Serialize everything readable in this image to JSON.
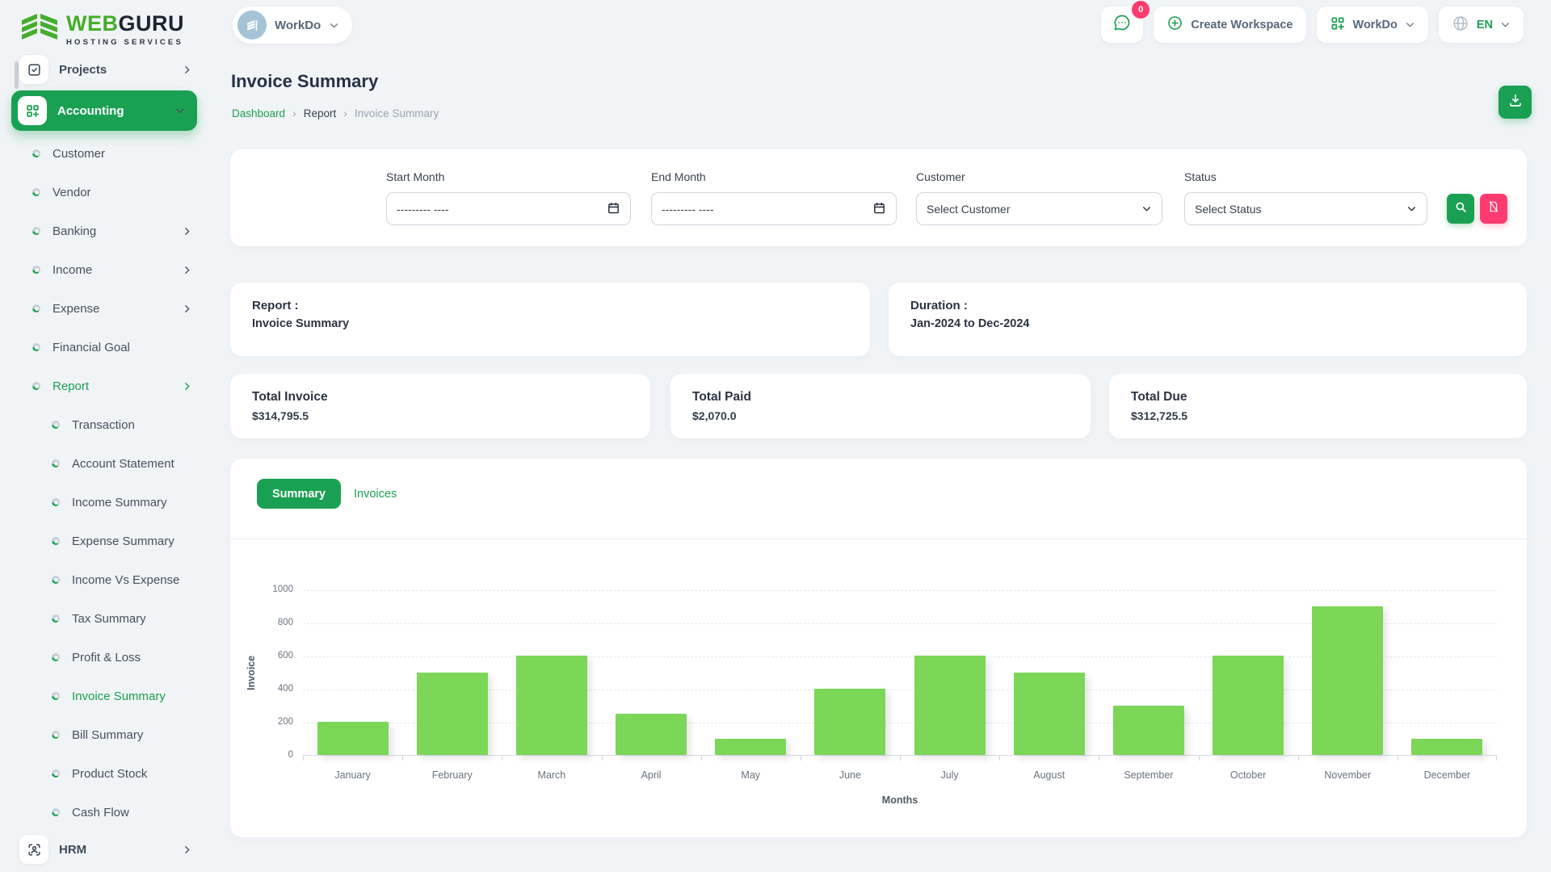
{
  "brand": {
    "web": "WEB",
    "guru": "GURU",
    "tagline": "HOSTING SERVICES"
  },
  "topbar": {
    "workspace": {
      "label": "WorkDo",
      "avatar_icon": "building-icon"
    },
    "messages_badge": "0",
    "messages_icon": "chat-bubble-icon",
    "create_workspace_label": "Create Workspace",
    "create_workspace_icon": "plus-circle-icon",
    "app_label": "WorkDo",
    "app_icon": "grid-plus-icon",
    "language_code": "EN",
    "language_icon": "globe-icon"
  },
  "sidebar": {
    "items": [
      {
        "label": "Projects",
        "type": "top",
        "icon": "checkbox-icon",
        "chevron": "right"
      },
      {
        "label": "Accounting",
        "type": "top-active",
        "icon": "grid-plus-icon",
        "chevron": "down"
      },
      {
        "label": "Customer",
        "type": "sub1"
      },
      {
        "label": "Vendor",
        "type": "sub1"
      },
      {
        "label": "Banking",
        "type": "sub1",
        "chevron": "right"
      },
      {
        "label": "Income",
        "type": "sub1",
        "chevron": "right"
      },
      {
        "label": "Expense",
        "type": "sub1",
        "chevron": "right"
      },
      {
        "label": "Financial Goal",
        "type": "sub1"
      },
      {
        "label": "Report",
        "type": "sub1",
        "chevron": "right",
        "active": true
      },
      {
        "label": "Transaction",
        "type": "sub2"
      },
      {
        "label": "Account Statement",
        "type": "sub2"
      },
      {
        "label": "Income Summary",
        "type": "sub2"
      },
      {
        "label": "Expense Summary",
        "type": "sub2"
      },
      {
        "label": "Income Vs Expense",
        "type": "sub2"
      },
      {
        "label": "Tax Summary",
        "type": "sub2"
      },
      {
        "label": "Profit & Loss",
        "type": "sub2"
      },
      {
        "label": "Invoice Summary",
        "type": "sub2",
        "active": true
      },
      {
        "label": "Bill Summary",
        "type": "sub2"
      },
      {
        "label": "Product Stock",
        "type": "sub2"
      },
      {
        "label": "Cash Flow",
        "type": "sub2"
      },
      {
        "label": "HRM",
        "type": "top",
        "icon": "user-scan-icon",
        "chevron": "right"
      }
    ]
  },
  "page": {
    "title": "Invoice Summary",
    "breadcrumb": {
      "items": [
        {
          "label": "Dashboard"
        },
        {
          "label": "Report"
        },
        {
          "label": "Invoice Summary"
        }
      ]
    }
  },
  "filters": {
    "start_month": {
      "label": "Start Month",
      "placeholder": "--------- ----"
    },
    "end_month": {
      "label": "End Month",
      "placeholder": "--------- ----"
    },
    "customer": {
      "label": "Customer",
      "value": "Select Customer"
    },
    "status": {
      "label": "Status",
      "value": "Select Status"
    },
    "search_icon": "search-icon",
    "reset_icon": "file-slash-icon"
  },
  "report_card": {
    "label": "Report :",
    "value": "Invoice Summary"
  },
  "duration_card": {
    "label": "Duration :",
    "value": "Jan-2024 to Dec-2024"
  },
  "totals": [
    {
      "label": "Total Invoice",
      "value": "$314,795.5"
    },
    {
      "label": "Total Paid",
      "value": "$2,070.0"
    },
    {
      "label": "Total Due",
      "value": "$312,725.5"
    }
  ],
  "tabs": [
    {
      "label": "Summary",
      "active": true
    },
    {
      "label": "Invoices",
      "active": false
    }
  ],
  "chart_data": {
    "type": "bar",
    "categories": [
      "January",
      "February",
      "March",
      "April",
      "May",
      "June",
      "July",
      "August",
      "September",
      "October",
      "November",
      "December"
    ],
    "values": [
      200,
      500,
      600,
      250,
      100,
      400,
      600,
      500,
      300,
      600,
      900,
      100
    ],
    "title": "",
    "xlabel": "Months",
    "ylabel": "Invoice",
    "ylim": [
      0,
      1000
    ],
    "yticks": [
      0,
      200,
      400,
      600,
      800,
      1000
    ],
    "grid": "dashed-horizontal",
    "legend_position": "none",
    "bar_color": "#7cd658"
  },
  "colors": {
    "primary": "#1aa053",
    "pink": "#ff3a6e",
    "bar": "#7cd658",
    "background": "#f1f4f7"
  }
}
